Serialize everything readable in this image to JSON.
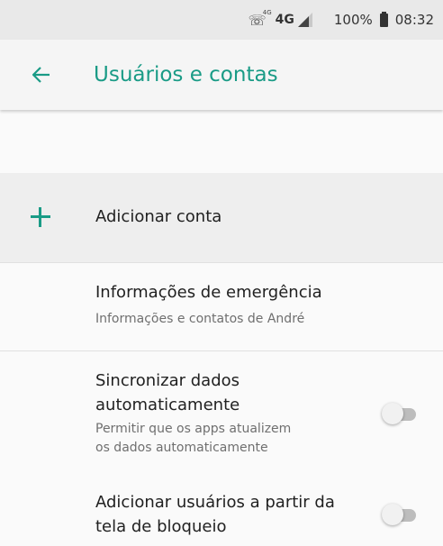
{
  "status_bar": {
    "call_badge": "4G",
    "network": "4G",
    "battery": "100%",
    "time": "08:32"
  },
  "app_bar": {
    "title": "Usuários e contas"
  },
  "items": {
    "add_account": {
      "label": "Adicionar conta"
    },
    "emergency": {
      "title": "Informações de emergência",
      "subtitle": "Informações e contatos de André"
    },
    "sync": {
      "title_line1": "Sincronizar dados",
      "title_line2": "automaticamente",
      "subtitle_line1": "Permitir que os apps atualizem",
      "subtitle_line2": "os dados automaticamente",
      "enabled": false
    },
    "lockscreen_users": {
      "title_line1": "Adicionar usuários a partir da",
      "title_line2": "tela de bloqueio",
      "enabled": false
    }
  },
  "colors": {
    "accent": "#1a9b86",
    "toggle_off_track": "#bdbdbd"
  }
}
